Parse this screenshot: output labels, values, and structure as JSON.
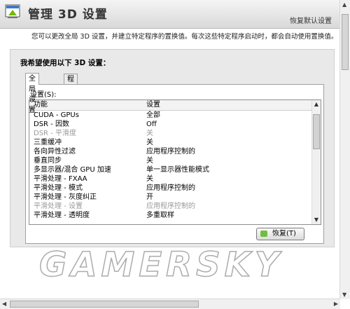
{
  "header": {
    "title": "管理 3D 设置",
    "restore_defaults_link": "恢复默认设置"
  },
  "description": "您可以更改全局 3D 设置，并建立特定程序的置换值。每次这些特定程序启动时，都会自动使用置换值。",
  "panel": {
    "heading": "我希望使用以下 3D 设置：",
    "tabs": [
      {
        "label": "全局设置",
        "active": true
      },
      {
        "label": "程序设置",
        "active": false
      }
    ],
    "settings_label": "设置(S):",
    "columns": {
      "feature": "功能",
      "setting": "设置"
    },
    "rows": [
      {
        "feature": "CUDA - GPUs",
        "setting": "全部",
        "disabled": false
      },
      {
        "feature": "DSR - 因数",
        "setting": "Off",
        "disabled": false
      },
      {
        "feature": "DSR - 平滑度",
        "setting": "关",
        "disabled": true
      },
      {
        "feature": "三重缓冲",
        "setting": "关",
        "disabled": false
      },
      {
        "feature": "各向异性过滤",
        "setting": "应用程序控制的",
        "disabled": false
      },
      {
        "feature": "垂直同步",
        "setting": "关",
        "disabled": false
      },
      {
        "feature": "多显示器/混合 GPU 加速",
        "setting": "单一显示器性能模式",
        "disabled": false
      },
      {
        "feature": "平滑处理 - FXAA",
        "setting": "关",
        "disabled": false
      },
      {
        "feature": "平滑处理 - 模式",
        "setting": "应用程序控制的",
        "disabled": false
      },
      {
        "feature": "平滑处理 - 灰度纠正",
        "setting": "开",
        "disabled": false
      },
      {
        "feature": "平滑处理 - 设置",
        "setting": "应用程序控制的",
        "disabled": true
      },
      {
        "feature": "平滑处理 - 透明度",
        "setting": "多重取样",
        "disabled": false
      }
    ],
    "restore_button": "恢复(T)"
  },
  "watermark": "GAMERSKY",
  "icons": {
    "app": "nvidia-3d-settings-icon",
    "restore": "restore-icon"
  }
}
